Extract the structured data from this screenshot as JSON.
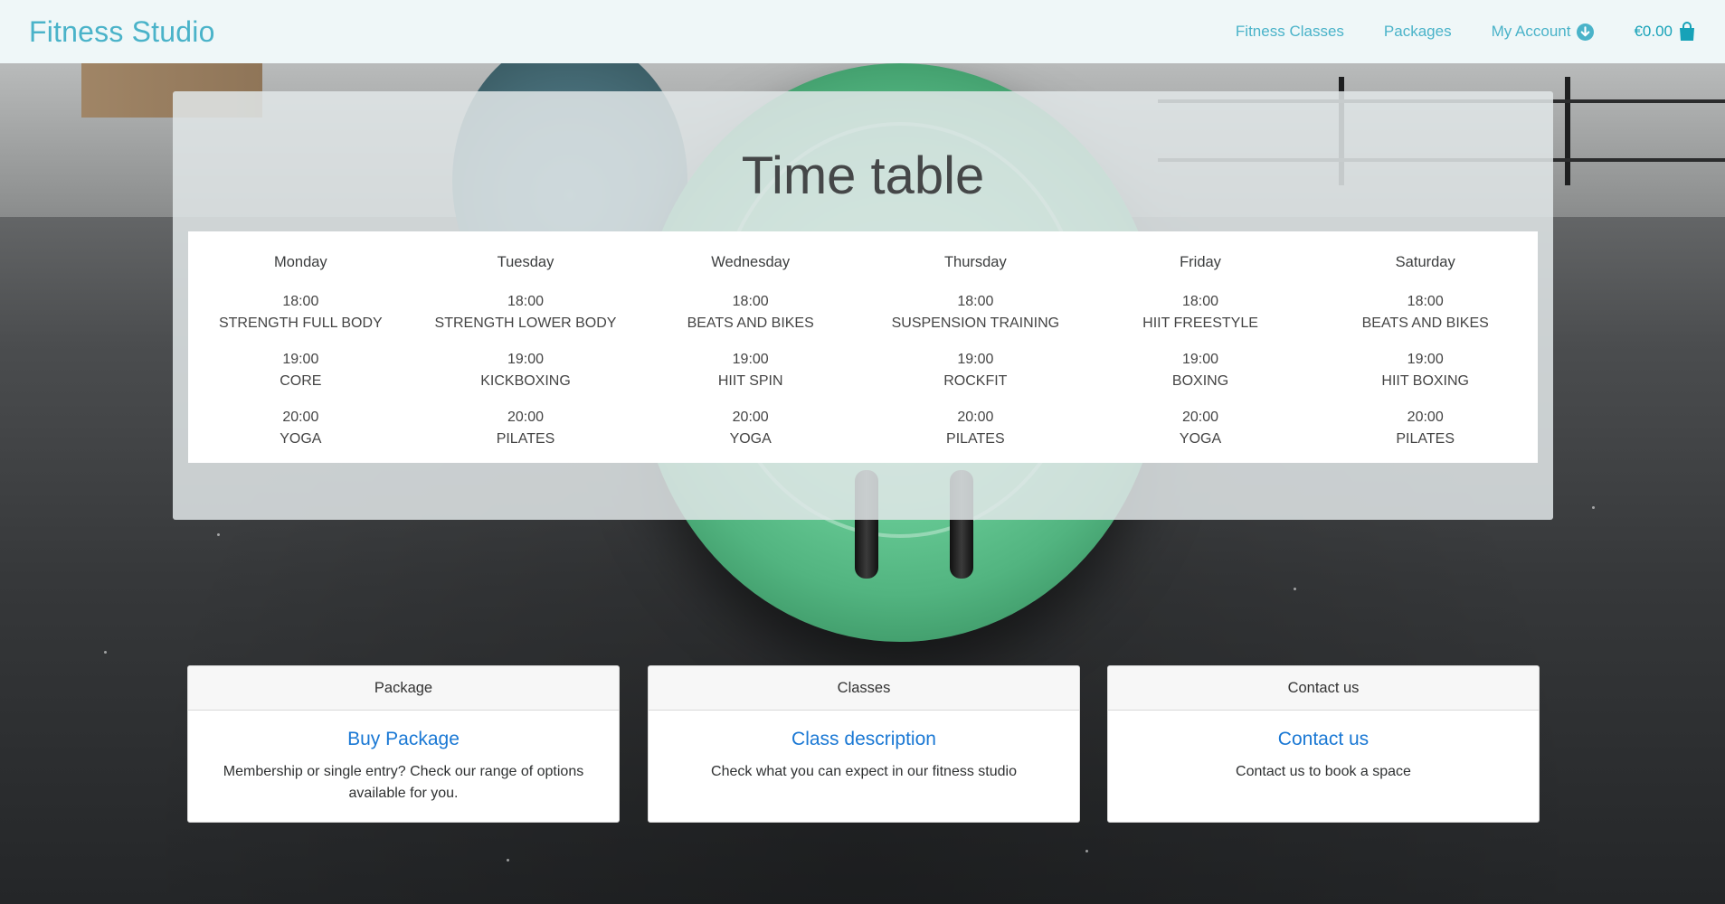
{
  "navbar": {
    "brand": "Fitness Studio",
    "links": {
      "classes": "Fitness Classes",
      "packages": "Packages",
      "account": "My Account",
      "cart_total": "€0.00"
    },
    "icons": {
      "account": "circle-arrow-down-icon",
      "cart": "shopping-bag-icon"
    },
    "colors": {
      "link": "#4ab3c9",
      "cart": "#17a2b8",
      "background": "#eff7f8"
    }
  },
  "timetable": {
    "title": "Time table",
    "days": [
      {
        "name": "Monday",
        "slots": [
          {
            "time": "18:00",
            "class": "STRENGTH FULL BODY"
          },
          {
            "time": "19:00",
            "class": "CORE"
          },
          {
            "time": "20:00",
            "class": "YOGA"
          }
        ]
      },
      {
        "name": "Tuesday",
        "slots": [
          {
            "time": "18:00",
            "class": "STRENGTH LOWER BODY"
          },
          {
            "time": "19:00",
            "class": "KICKBOXING"
          },
          {
            "time": "20:00",
            "class": "PILATES"
          }
        ]
      },
      {
        "name": "Wednesday",
        "slots": [
          {
            "time": "18:00",
            "class": "BEATS AND BIKES"
          },
          {
            "time": "19:00",
            "class": "HIIT SPIN"
          },
          {
            "time": "20:00",
            "class": "YOGA"
          }
        ]
      },
      {
        "name": "Thursday",
        "slots": [
          {
            "time": "18:00",
            "class": "SUSPENSION TRAINING"
          },
          {
            "time": "19:00",
            "class": "ROCKFIT"
          },
          {
            "time": "20:00",
            "class": "PILATES"
          }
        ]
      },
      {
        "name": "Friday",
        "slots": [
          {
            "time": "18:00",
            "class": "HIIT FREESTYLE"
          },
          {
            "time": "19:00",
            "class": "BOXING"
          },
          {
            "time": "20:00",
            "class": "YOGA"
          }
        ]
      },
      {
        "name": "Saturday",
        "slots": [
          {
            "time": "18:00",
            "class": "BEATS AND BIKES"
          },
          {
            "time": "19:00",
            "class": "HIIT BOXING"
          },
          {
            "time": "20:00",
            "class": "PILATES"
          }
        ]
      }
    ]
  },
  "cards": [
    {
      "header": "Package",
      "title": "Buy Package",
      "text": "Membership or single entry? Check our range of options available for you."
    },
    {
      "header": "Classes",
      "title": "Class description",
      "text": "Check what you can expect in our fitness studio"
    },
    {
      "header": "Contact us",
      "title": "Contact us",
      "text": "Contact us to book a space"
    }
  ],
  "colors": {
    "card_link": "#1a78d4",
    "panel_background": "rgba(225,231,232,0.86)"
  }
}
